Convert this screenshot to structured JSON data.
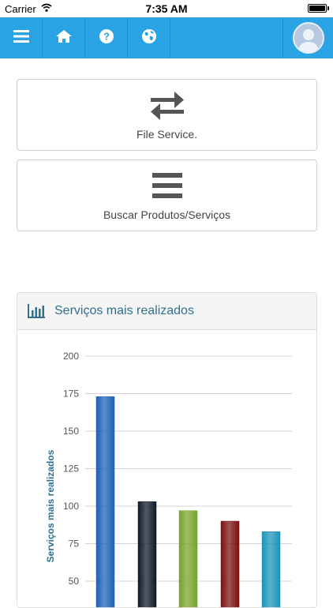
{
  "status_bar": {
    "carrier": "Carrier",
    "time": "7:35 AM"
  },
  "navbar": {
    "icons": [
      "menu-icon",
      "home-icon",
      "help-icon",
      "globe-icon"
    ],
    "accent": "#29a3e3",
    "avatar_icon": "user-avatar-icon"
  },
  "cards": {
    "file_service": {
      "label": "File Service.",
      "icon": "swap-arrows-icon"
    },
    "search": {
      "label": "Buscar Produtos/Serviços",
      "icon": "list-icon"
    }
  },
  "panel": {
    "title": "Serviços mais realizados",
    "icon": "bar-chart-icon"
  },
  "chart_data": {
    "type": "bar",
    "ylabel": "Serviços mais realizados",
    "ylim": [
      0,
      200
    ],
    "yticks": [
      "200",
      "175",
      "150",
      "125",
      "100",
      "75",
      "50"
    ],
    "grid": true,
    "values": [
      173,
      103,
      97,
      90,
      83
    ],
    "colors": [
      "#1e5fb8",
      "#0f1a2a",
      "#78a32a",
      "#7a1010",
      "#1b93b8"
    ]
  }
}
